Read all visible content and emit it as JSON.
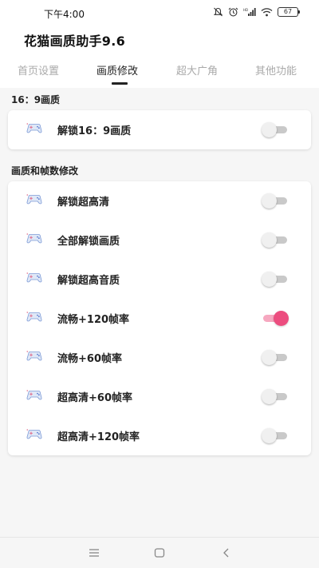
{
  "status_bar": {
    "time": "下午4:00",
    "battery": "67",
    "icons": [
      "mute-icon",
      "alarm-icon",
      "signal-icon",
      "wifi-icon",
      "battery-icon"
    ]
  },
  "app": {
    "title": "花猫画质助手9.6"
  },
  "tabs": [
    {
      "label": "首页设置",
      "active": false
    },
    {
      "label": "画质修改",
      "active": true
    },
    {
      "label": "超大广角",
      "active": false
    },
    {
      "label": "其他功能",
      "active": false
    }
  ],
  "sections": [
    {
      "title": "16：9画质",
      "items": [
        {
          "label": "解锁16：9画质",
          "enabled": false,
          "icon": "game-controller-icon"
        }
      ]
    },
    {
      "title": "画质和帧数修改",
      "items": [
        {
          "label": "解锁超高清",
          "enabled": false,
          "icon": "game-controller-icon"
        },
        {
          "label": "全部解锁画质",
          "enabled": false,
          "icon": "game-controller-icon"
        },
        {
          "label": "解锁超高音质",
          "enabled": false,
          "icon": "game-controller-icon"
        },
        {
          "label": "流畅+120帧率",
          "enabled": true,
          "icon": "game-controller-icon"
        },
        {
          "label": "流畅+60帧率",
          "enabled": false,
          "icon": "game-controller-icon"
        },
        {
          "label": "超高清+60帧率",
          "enabled": false,
          "icon": "game-controller-icon"
        },
        {
          "label": "超高清+120帧率",
          "enabled": false,
          "icon": "game-controller-icon"
        }
      ]
    }
  ],
  "nav_bar": {
    "icons": [
      "menu-icon",
      "home-icon",
      "back-icon"
    ]
  },
  "colors": {
    "accent": "#ec4d7f",
    "accent_track": "#f6a8c0",
    "toggle_off": "#c9c9c9"
  }
}
